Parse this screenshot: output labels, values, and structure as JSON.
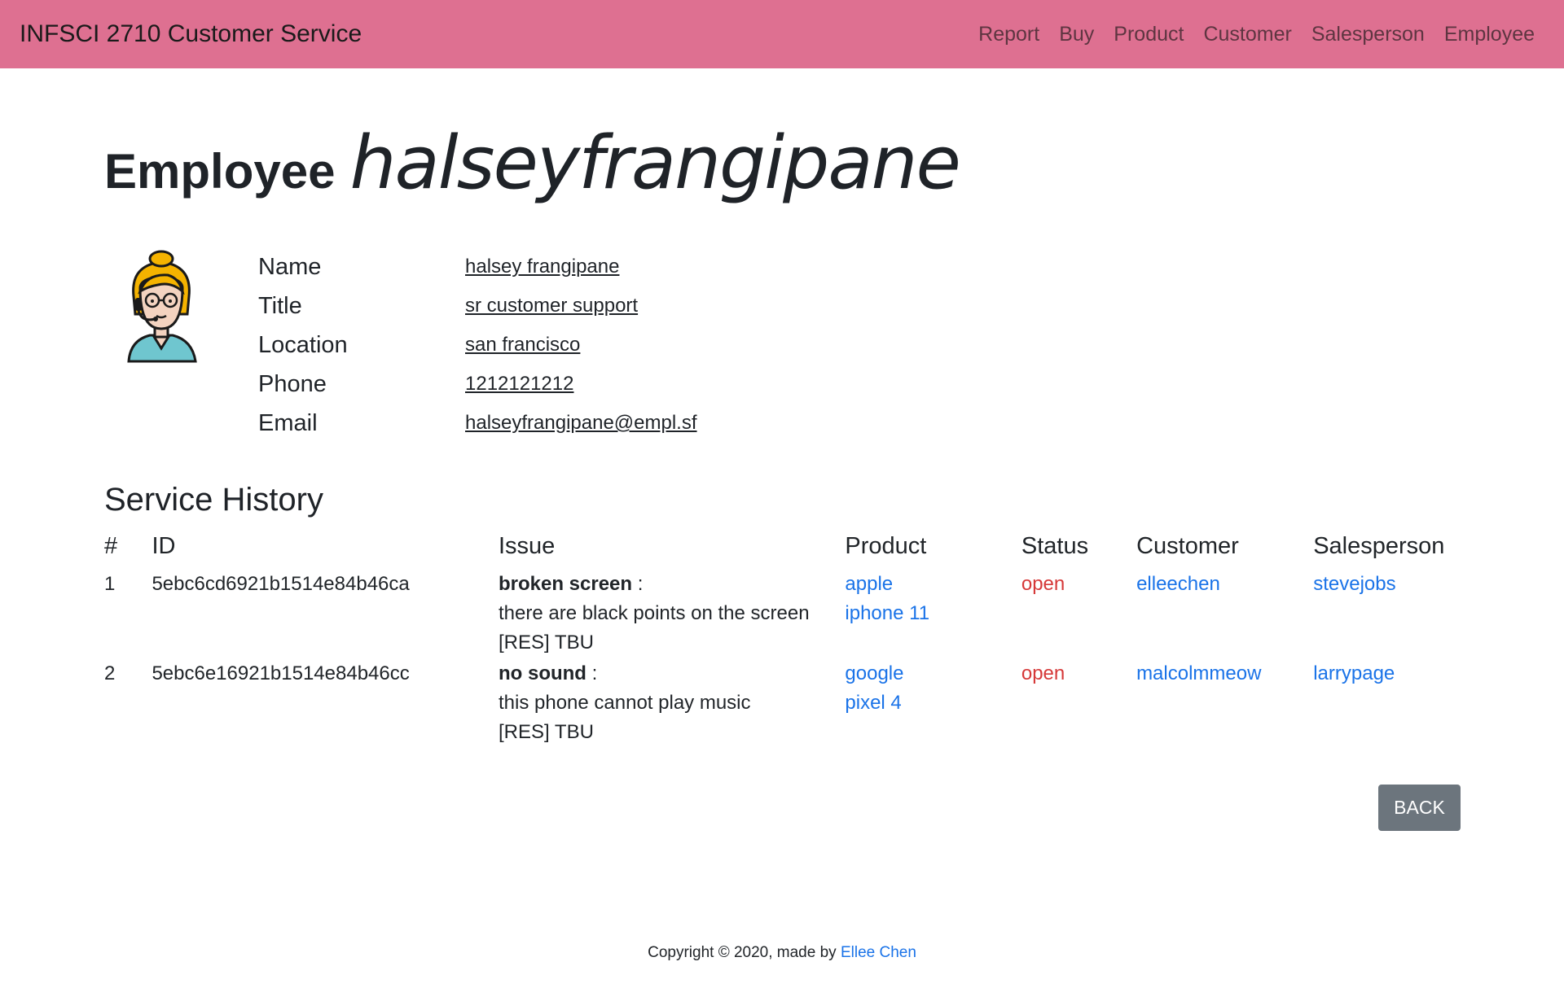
{
  "navbar": {
    "brand": "INFSCI 2710 Customer Service",
    "links": [
      "Report",
      "Buy",
      "Product",
      "Customer",
      "Salesperson",
      "Employee"
    ]
  },
  "page": {
    "title_label": "Employee",
    "title_user": "halseyfrangipane"
  },
  "employee": {
    "fields": [
      {
        "label": "Name",
        "value": "halsey frangipane"
      },
      {
        "label": "Title",
        "value": "sr customer support"
      },
      {
        "label": "Location",
        "value": "san francisco"
      },
      {
        "label": "Phone",
        "value": "1212121212"
      },
      {
        "label": "Email",
        "value": "halseyfrangipane@empl.sf"
      }
    ]
  },
  "history": {
    "title": "Service History",
    "headers": [
      "#",
      "ID",
      "Issue",
      "Product",
      "Status",
      "Customer",
      "Salesperson"
    ],
    "rows": [
      {
        "num": "1",
        "id": "5ebc6cd6921b1514e84b46ca",
        "issue_title": "broken screen",
        "issue_sep": " :",
        "issue_desc": "there are black points on the screen",
        "issue_res": "[RES] TBU",
        "product_brand": "apple",
        "product_model": "iphone 11",
        "status": "open",
        "customer": "elleechen",
        "salesperson": "stevejobs"
      },
      {
        "num": "2",
        "id": "5ebc6e16921b1514e84b46cc",
        "issue_title": "no sound",
        "issue_sep": " :",
        "issue_desc": "this phone cannot play music",
        "issue_res": "[RES] TBU",
        "product_brand": "google",
        "product_model": "pixel 4",
        "status": "open",
        "customer": "malcolmmeow",
        "salesperson": "larrypage"
      }
    ]
  },
  "actions": {
    "back_label": "BACK"
  },
  "footer": {
    "text": "Copyright © 2020, made by ",
    "author": "Ellee Chen"
  },
  "colors": {
    "navbar_bg": "#de7091",
    "link": "#1a73e8",
    "status_open": "#d63838",
    "button_bg": "#6c757d"
  },
  "icons": {
    "avatar": "support-agent-avatar-icon"
  }
}
